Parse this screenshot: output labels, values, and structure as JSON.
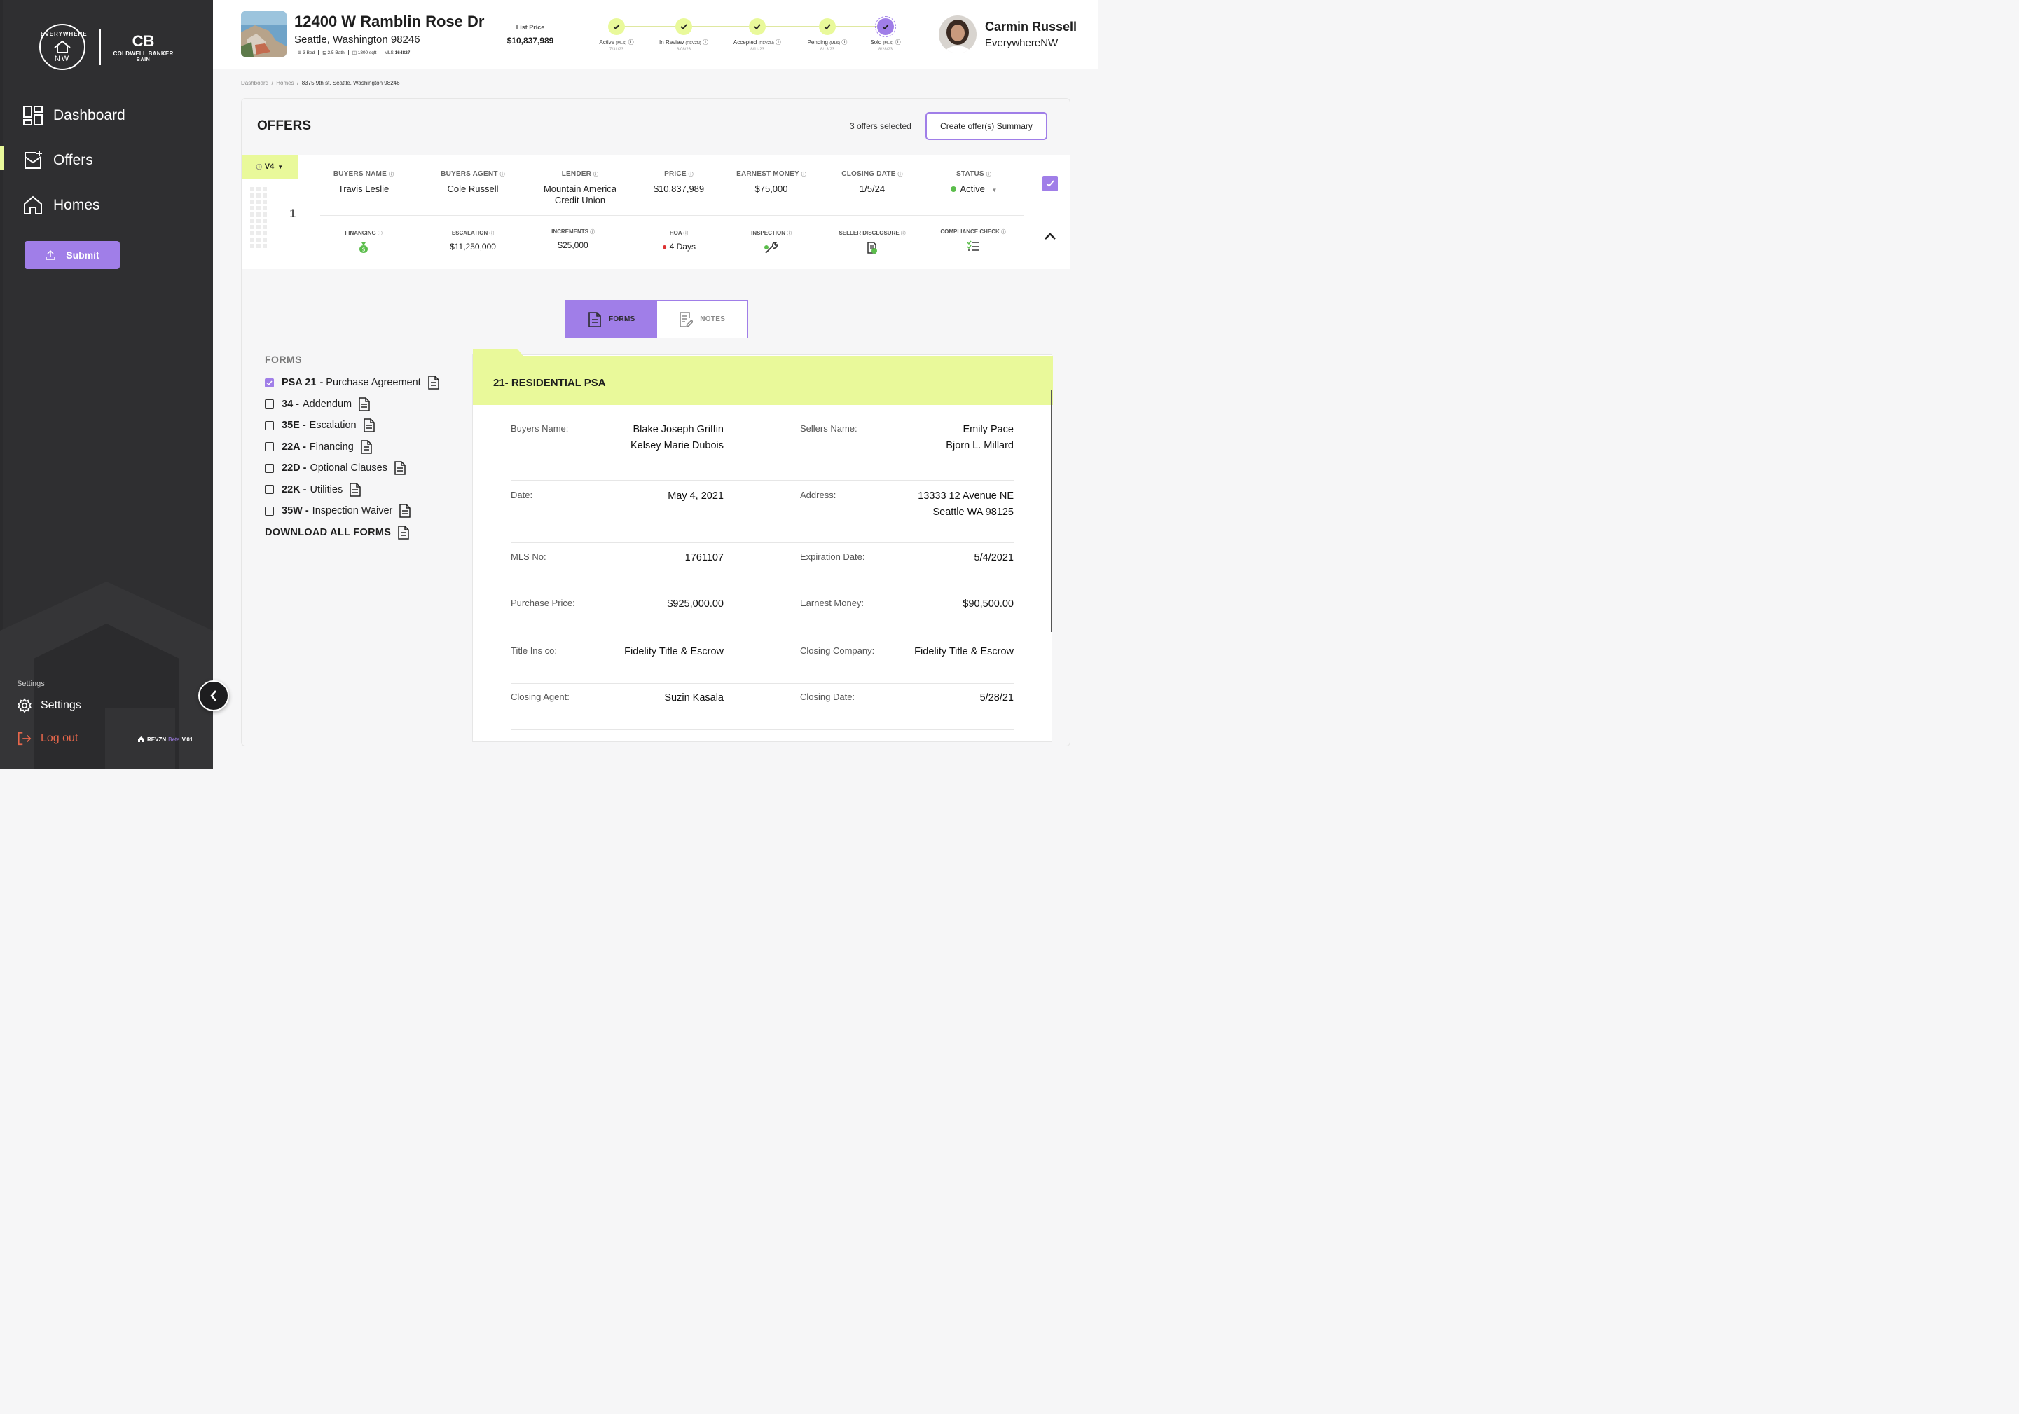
{
  "sidebar": {
    "logo_top": "EVERYWHERE",
    "logo_bottom": "NW",
    "cb_mark": "CB",
    "cb_name": "COLDWELL BANKER",
    "cb_sub": "BAIN",
    "nav": [
      {
        "label": "Dashboard",
        "icon": "dashboard-icon"
      },
      {
        "label": "Offers",
        "icon": "offers-icon"
      },
      {
        "label": "Homes",
        "icon": "home-icon"
      }
    ],
    "submit_label": "Submit",
    "settings_section": "Settings",
    "settings_label": "Settings",
    "logout_label": "Log out",
    "brand": "REVZN",
    "beta": "Beta",
    "version": "V.01"
  },
  "header": {
    "address_line1": "12400 W Ramblin Rose Dr",
    "address_line2": "Seattle, Washington 98246",
    "beds": "3 Bed",
    "baths": "2.5 Bath",
    "sqft": "1800 sqft",
    "mls_label": "MLS",
    "mls": "164827",
    "list_price_label": "List Price",
    "list_price": "$10,837,989",
    "steps": [
      {
        "label": "Active",
        "source": "(MLS)",
        "date": "7/31/23",
        "state": "done"
      },
      {
        "label": "In Review",
        "source": "(REVZN)",
        "date": "8/08/23",
        "state": "done"
      },
      {
        "label": "Accepted",
        "source": "(REVZN)",
        "date": "8/11/23",
        "state": "done"
      },
      {
        "label": "Pending",
        "source": "(MLS)",
        "date": "8/13/23",
        "state": "done"
      },
      {
        "label": "Sold",
        "source": "(MLS)",
        "date": "8/28/23",
        "state": "current"
      }
    ],
    "user_name": "Carmin Russell",
    "user_org": "EverywhereNW"
  },
  "breadcrumb": {
    "items": [
      "Dashboard",
      "Homes"
    ],
    "current": "8375 9th st. Seattle, Washington 98246"
  },
  "offers": {
    "title": "OFFERS",
    "selected_count": "3 offers selected",
    "create_label": "Create offer(s) Summary",
    "version": "V4",
    "row_number": "1",
    "top_fields": [
      {
        "header": "BUYERS NAME",
        "value": "Travis Leslie"
      },
      {
        "header": "BUYERS AGENT",
        "value": "Cole Russell"
      },
      {
        "header": "LENDER",
        "value": "Mountain America Credit Union"
      },
      {
        "header": "PRICE",
        "value": "$10,837,989"
      },
      {
        "header": "EARNEST MONEY",
        "value": "$75,000"
      },
      {
        "header": "CLOSING DATE",
        "value": "1/5/24"
      },
      {
        "header": "STATUS",
        "value": "Active"
      }
    ],
    "bottom_fields": [
      {
        "header": "FINANCING",
        "value": ""
      },
      {
        "header": "ESCALATION",
        "value": "$11,250,000"
      },
      {
        "header": "INCREMENTS",
        "value": "$25,000"
      },
      {
        "header": "HOA",
        "value": "4 Days"
      },
      {
        "header": "INSPECTION",
        "value": ""
      },
      {
        "header": "SELLER DISCLOSURE",
        "value": ""
      },
      {
        "header": "COMPLIANCE CHECK",
        "value": ""
      }
    ]
  },
  "tabs": {
    "forms": "FORMS",
    "notes": "NOTES"
  },
  "forms": {
    "title": "FORMS",
    "items": [
      {
        "code": "PSA 21",
        "name": " - Purchase Agreement",
        "checked": true
      },
      {
        "code": "34 -",
        "name": "Addendum",
        "checked": false
      },
      {
        "code": "35E -",
        "name": "Escalation",
        "checked": false
      },
      {
        "code": "22A -",
        "name": "Financing",
        "checked": false
      },
      {
        "code": "22D -",
        "name": "Optional Clauses",
        "checked": false
      },
      {
        "code": "22K -",
        "name": "Utilities",
        "checked": false
      },
      {
        "code": "35W -",
        "name": "Inspection Waiver",
        "checked": false
      }
    ],
    "download_all": "DOWNLOAD ALL FORMS"
  },
  "psa": {
    "title": "21- RESIDENTIAL PSA",
    "rows": [
      {
        "left_label": "Buyers Name:",
        "left_value": [
          "Blake Joseph Griffin",
          "Kelsey Marie Dubois"
        ],
        "right_label": "Sellers Name:",
        "right_value": [
          "Emily Pace",
          "Bjorn L. Millard"
        ]
      },
      {
        "left_label": "Date:",
        "left_value": [
          "May 4, 2021"
        ],
        "right_label": "Address:",
        "right_value": [
          "13333 12 Avenue NE",
          "Seattle WA 98125"
        ]
      },
      {
        "left_label": "MLS No:",
        "left_value": [
          "1761107"
        ],
        "right_label": "Expiration Date:",
        "right_value": [
          "5/4/2021"
        ]
      },
      {
        "left_label": "Purchase Price:",
        "left_value": [
          "$925,000.00"
        ],
        "right_label": "Earnest Money:",
        "right_value": [
          "$90,500.00"
        ]
      },
      {
        "left_label": "Title Ins co:",
        "left_value": [
          "Fidelity Title & Escrow"
        ],
        "right_label": "Closing Company:",
        "right_value": [
          "Fidelity Title & Escrow"
        ]
      },
      {
        "left_label": "Closing Agent:",
        "left_value": [
          "Suzin Kasala"
        ],
        "right_label": "Closing Date:",
        "right_value": [
          "5/28/21"
        ]
      }
    ]
  },
  "colors": {
    "accent_purple": "#a07ee8",
    "accent_lime": "#e9f99a",
    "sidebar_bg": "#2b2b2d",
    "logout_red": "#e8674b",
    "status_green": "#5bbd4b"
  }
}
